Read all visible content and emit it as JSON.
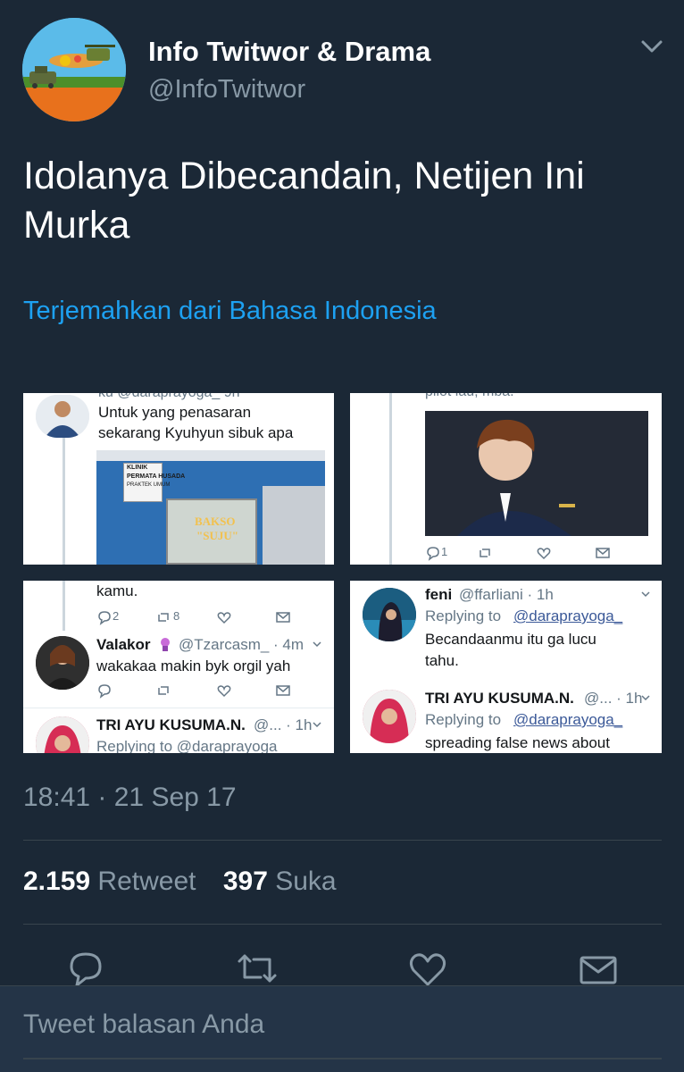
{
  "account": {
    "name": "Info Twitwor & Drama",
    "handle": "@InfoTwitwor"
  },
  "tweet": {
    "text": "Idolanya Dibecandain, Netijen Ini Murka",
    "translate_label": "Terjemahkan dari Bahasa Indonesia",
    "timestamp": "18:41 · 21 Sep 17"
  },
  "media": {
    "tile1": {
      "top_cut": "ku @daraprayoga_ 9h",
      "line1": "Untuk yang penasaran",
      "line2": "sekarang Kyuhyun sibuk apa",
      "sign_klinik": "KLINIK",
      "sign_name": "PERMATA HUSADA",
      "sign_sub": "PRAKTEK UMUM",
      "stall_line1": "BAKSO",
      "stall_line2": "\"SUJU\""
    },
    "tile2": {
      "top_cut": "pilot lau, mba.",
      "reply_count": "1"
    },
    "tile3": {
      "top_cut": "kamu.",
      "reply_count": "2",
      "retweet_count": "8",
      "user_name": "Valakor",
      "user_handle": "@Tzarcasm_ · 4m",
      "user_text": "wakakaa makin byk orgil yah",
      "next_name": "TRI AYU KUSUMA.N.",
      "next_handle": "@... · 1h",
      "next_reply": "Replying to @daraprayoga_"
    },
    "tile4": {
      "name1": "feni",
      "handle1": "@ffarliani · 1h",
      "replying_prefix": "Replying to",
      "replying_user": "@daraprayoga_",
      "text1_line1": "Becandaanmu itu ga lucu",
      "text1_line2": "tahu.",
      "name2": "TRI AYU KUSUMA.N.",
      "handle2": "@... · 1h",
      "text2": "spreading false news about"
    }
  },
  "stats": {
    "retweets_count": "2.159",
    "retweets_label": "Retweet",
    "likes_count": "397",
    "likes_label": "Suka"
  },
  "reply": {
    "placeholder": "Tweet balasan Anda"
  },
  "colors": {
    "background": "#1b2836",
    "link": "#1da1f2",
    "secondary_text": "#8899a6",
    "divider": "#38444d"
  }
}
